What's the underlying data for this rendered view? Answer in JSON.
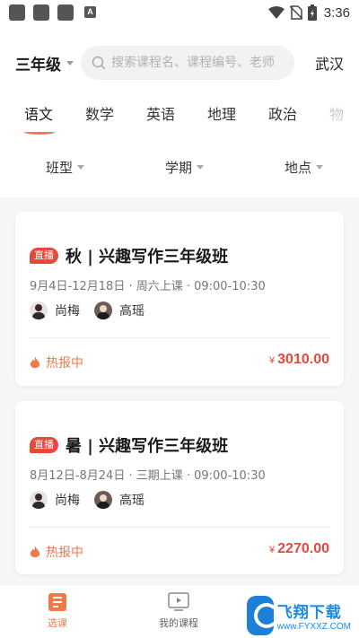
{
  "status_bar": {
    "time": "3:36",
    "left_icons": [
      "notification-icon",
      "notification-icon",
      "notification-icon",
      "a-icon"
    ],
    "a_glyph": "A",
    "right_icons": [
      "wifi-icon",
      "no-sim-icon",
      "battery-charging-icon"
    ]
  },
  "header": {
    "grade": "三年级",
    "search_placeholder": "搜索课程名、课程编号、老师",
    "city": "武汉"
  },
  "subject_tabs": [
    {
      "label": "语文",
      "active": true
    },
    {
      "label": "数学",
      "active": false
    },
    {
      "label": "英语",
      "active": false
    },
    {
      "label": "地理",
      "active": false
    },
    {
      "label": "政治",
      "active": false
    },
    {
      "label": "物",
      "active": false
    }
  ],
  "filters": [
    {
      "label": "班型"
    },
    {
      "label": "学期"
    },
    {
      "label": "地点"
    }
  ],
  "courses": [
    {
      "badge": "直播",
      "title": "秋 | 兴趣写作三年级班",
      "schedule": "9月4日-12月18日 · 周六上课 · 09:00-10:30",
      "teachers": [
        "尚梅",
        "高瑶"
      ],
      "status": "热报中",
      "currency": "¥",
      "price": "3010.00"
    },
    {
      "badge": "直播",
      "title": "暑 | 兴趣写作三年级班",
      "schedule": "8月12日-8月24日 · 三期上课 · 09:00-10:30",
      "teachers": [
        "尚梅",
        "高瑶"
      ],
      "status": "热报中",
      "currency": "¥",
      "price": "2270.00"
    }
  ],
  "bottom_nav": [
    {
      "label": "选课",
      "icon": "book-icon",
      "active": true
    },
    {
      "label": "我的课程",
      "icon": "video-icon",
      "active": false
    }
  ],
  "watermark": {
    "text_cn": "飞翔下载",
    "text_en": "www.FYXXZ.COM"
  },
  "colors": {
    "accent": "#ee7a4a",
    "price": "#e8483c",
    "badge": "#e8483c",
    "watermark": "#1c8ae6"
  }
}
